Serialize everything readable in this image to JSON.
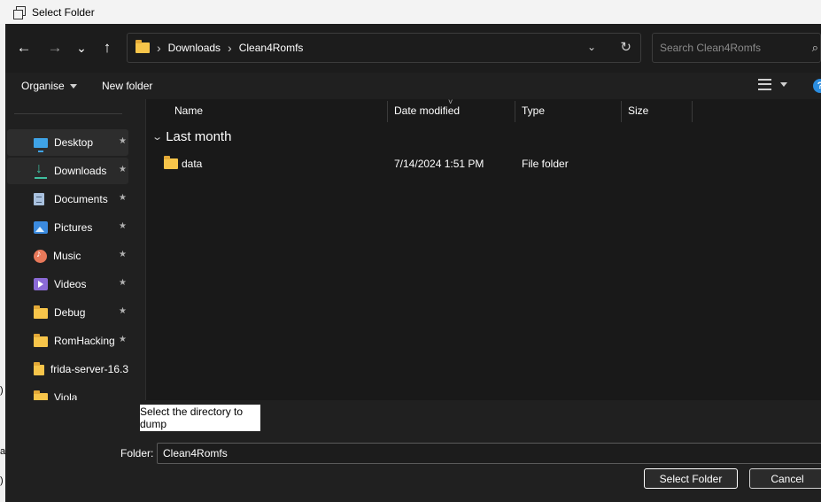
{
  "window": {
    "title": "Select Folder"
  },
  "nav": {
    "back": "←",
    "forward": "→",
    "recent": "⌄",
    "up": "↑"
  },
  "address": {
    "crumbs": [
      "Downloads",
      "Clean4Romfs"
    ],
    "separator": "›",
    "dropdown": "⌄",
    "refresh": "↻"
  },
  "search": {
    "placeholder": "Search Clean4Romfs",
    "icon": "⌕"
  },
  "toolbar": {
    "organise": "Organise",
    "new_folder": "New folder",
    "help": "?"
  },
  "sidebar": {
    "pin_glyph": "★",
    "items": [
      {
        "label": "Desktop",
        "icon": "desktop-icon",
        "pinned": true
      },
      {
        "label": "Downloads",
        "icon": "downloads-icon",
        "pinned": true
      },
      {
        "label": "Documents",
        "icon": "documents-icon",
        "pinned": true
      },
      {
        "label": "Pictures",
        "icon": "pictures-icon",
        "pinned": true
      },
      {
        "label": "Music",
        "icon": "music-icon",
        "pinned": true
      },
      {
        "label": "Videos",
        "icon": "videos-icon",
        "pinned": true
      },
      {
        "label": "Debug",
        "icon": "folder-icon",
        "pinned": true
      },
      {
        "label": "RomHacking",
        "icon": "folder-icon",
        "pinned": true
      },
      {
        "label": "frida-server-16.3",
        "icon": "folder-icon",
        "pinned": false
      },
      {
        "label": "Viola",
        "icon": "folder-icon",
        "pinned": false
      }
    ]
  },
  "filelist": {
    "columns": [
      "Name",
      "Date modified",
      "Type",
      "Size"
    ],
    "sort_indicator": "˅",
    "group": {
      "label": "Last month",
      "chevron": "⌄"
    },
    "rows": [
      {
        "name": "data",
        "date_modified": "7/14/2024 1:51 PM",
        "type": "File folder",
        "size": ""
      }
    ]
  },
  "footer": {
    "tooltip": "Select the directory to dump",
    "folder_label": "Folder:",
    "folder_value": "Clean4Romfs",
    "select_button": "Select Folder",
    "cancel_button": "Cancel"
  },
  "background": {
    "chars": [
      ")",
      "a",
      ")"
    ]
  },
  "colors": {
    "accent": "#2b8de0",
    "folder": "#f7c54a",
    "dialog_bg": "#202020",
    "list_bg": "#191919"
  }
}
